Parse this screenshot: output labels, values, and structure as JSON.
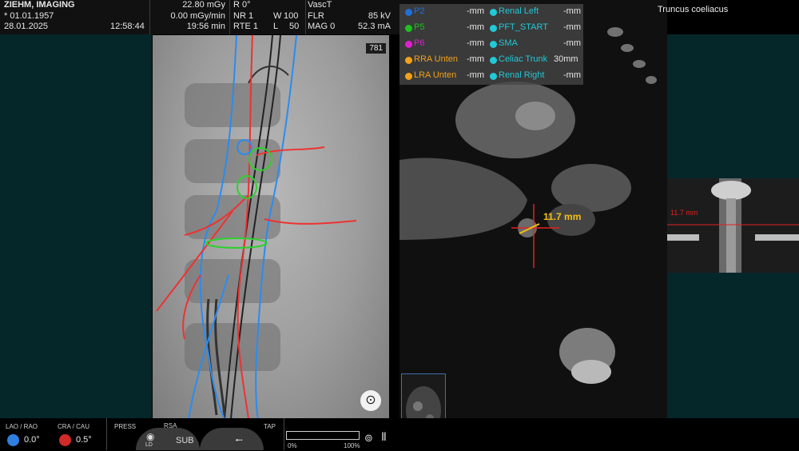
{
  "header": {
    "patient_name": "ZIEHM, IMAGING",
    "birth_date": "* 01.01.1957",
    "exam_date": "28.01.2025",
    "exam_time": "12:58:44",
    "dose": "22.80 mGy",
    "dose_rate": "0.00 mGy/min",
    "fluoro_time": "19:56 min",
    "r_label": "R 0°",
    "nr": "NR 1",
    "rte": "RTE 1",
    "w_label": "W",
    "w_value": "100",
    "l_label": "L",
    "l_value": "50",
    "mode": "VascT",
    "flr": "FLR",
    "kv": "85 kV",
    "mag": "MAG 0",
    "ma": "52.3 mA"
  },
  "fluoro": {
    "frame_number": "781",
    "logo": "fluoro-logo"
  },
  "ct": {
    "measurements": [
      {
        "label": "P2",
        "value": "-mm",
        "color": "#1e6fd9"
      },
      {
        "label": "P5",
        "value": "-mm",
        "color": "#1ec21e"
      },
      {
        "label": "P6",
        "value": "-mm",
        "color": "#e020d0"
      },
      {
        "label": "RRA Unten",
        "value": "-mm",
        "color": "#f2a21a"
      },
      {
        "label": "LRA Unten",
        "value": "-mm",
        "color": "#f2a21a"
      }
    ],
    "measurements_right": [
      {
        "label": "Renal Left",
        "value": "-mm",
        "color": "#20c8d8"
      },
      {
        "label": "PFT_START",
        "value": "-mm",
        "color": "#20c8d8"
      },
      {
        "label": "SMA",
        "value": "-mm",
        "color": "#20c8d8"
      },
      {
        "label": "Celiac Trunk",
        "value": "30mm",
        "color": "#20c8d8"
      },
      {
        "label": "Renal Right",
        "value": "-mm",
        "color": "#20c8d8"
      }
    ],
    "diameter_label": "11.7 mm"
  },
  "right_panel": {
    "title": "Truncus coeliacus",
    "recon_label": "11.7 mm"
  },
  "bottom": {
    "lao_rao_label": "LAO / RAO",
    "lao_rao_value": "0.0°",
    "cra_cau_label": "CRA / CAU",
    "cra_cau_value": "0.5°",
    "press_label": "PRESS",
    "rsa_label": "RSA",
    "ld_label": "LD",
    "sub_label": "SUB",
    "tap_label": "TAP",
    "progress_min": "0%",
    "progress_max": "100%",
    "progress_value": 0
  }
}
